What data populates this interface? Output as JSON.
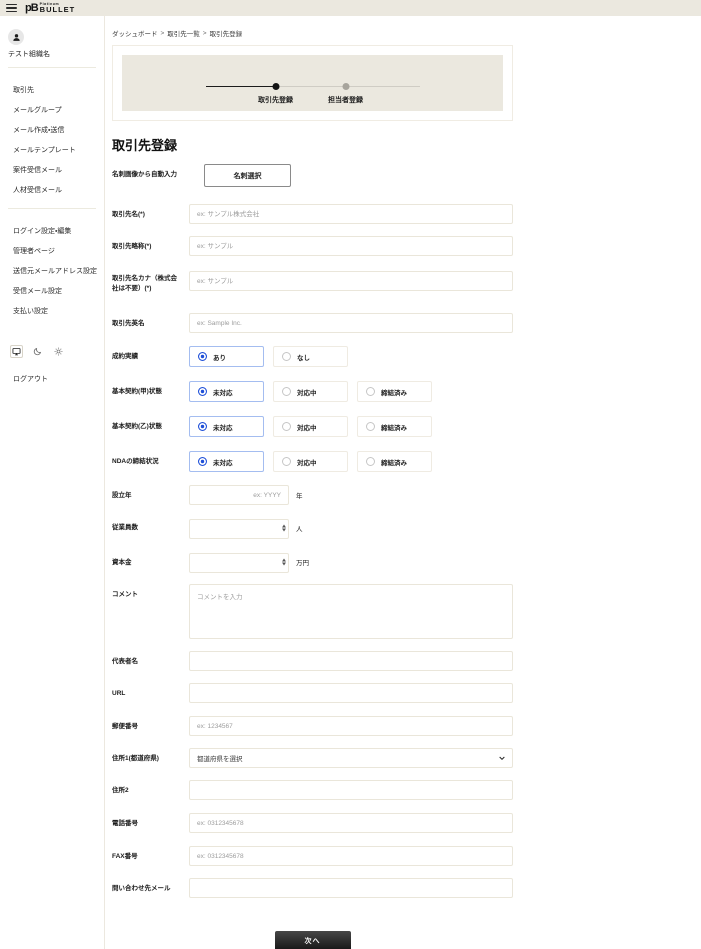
{
  "colors": {
    "accent_blue": "#1d4ed8",
    "selected_border": "#a4bdf0",
    "beige": "#ebe8df",
    "input_border": "#eae6da"
  },
  "header": {
    "logo_mark": "pB",
    "logo_small": "Platinum",
    "logo_main": "BULLET"
  },
  "sidebar": {
    "org_name": "テスト組織名",
    "nav_primary": [
      {
        "label": "取引先"
      },
      {
        "label": "メールグループ"
      },
      {
        "label": "メール作成・送信"
      },
      {
        "label": "メールテンプレート"
      },
      {
        "label": "案件受信メール"
      },
      {
        "label": "人材受信メール"
      }
    ],
    "nav_secondary": [
      {
        "label": "ログイン設定・編集"
      },
      {
        "label": "管理者ページ"
      },
      {
        "label": "送信元メールアドレス設定"
      },
      {
        "label": "受信メール設定"
      },
      {
        "label": "支払い設定"
      }
    ],
    "theme_icons": [
      "monitor-icon",
      "moon-icon",
      "sun-icon"
    ],
    "logout_label": "ログアウト"
  },
  "breadcrumb": {
    "items": [
      "ダッシュボード",
      "取引先一覧",
      "取引先登録"
    ],
    "separator": ">"
  },
  "stepper": {
    "steps": [
      {
        "label": "取引先登録",
        "state": "active"
      },
      {
        "label": "担当者登録",
        "state": "inactive"
      }
    ]
  },
  "form": {
    "title": "取引先登録",
    "business_card": {
      "label": "名刺画像から自動入力",
      "button_label": "名刺選択"
    },
    "fields": {
      "partner_name": {
        "label": "取引先名(*)",
        "placeholder": "ex: サンプル株式会社"
      },
      "partner_abbr": {
        "label": "取引先略称(*)",
        "placeholder": "ex: サンプル"
      },
      "partner_kana": {
        "label": "取引先名カナ（株式会社は不要）(*)",
        "placeholder": "ex: サンプル"
      },
      "partner_en": {
        "label": "取引先英名",
        "placeholder": "ex: Sample Inc."
      },
      "deal_record": {
        "label": "成約実績",
        "options": [
          "あり",
          "なし"
        ],
        "selected_index": 0
      },
      "contract_kou": {
        "label": "基本契約(甲)状態",
        "options": [
          "未対応",
          "対応中",
          "締結済み"
        ],
        "selected_index": 0
      },
      "contract_otsu": {
        "label": "基本契約(乙)状態",
        "options": [
          "未対応",
          "対応中",
          "締結済み"
        ],
        "selected_index": 0
      },
      "nda": {
        "label": "NDAの締結状況",
        "options": [
          "未対応",
          "対応中",
          "締結済み"
        ],
        "selected_index": 0
      },
      "founded_year": {
        "label": "設立年",
        "placeholder": "ex: YYYY",
        "unit": "年"
      },
      "employees": {
        "label": "従業員数",
        "unit": "人"
      },
      "capital": {
        "label": "資本金",
        "unit": "万円"
      },
      "comment": {
        "label": "コメント",
        "placeholder": "コメントを入力"
      },
      "representative": {
        "label": "代表者名"
      },
      "url": {
        "label": "URL"
      },
      "postal_code": {
        "label": "郵便番号",
        "placeholder": "ex: 1234567"
      },
      "address1": {
        "label": "住所1(都道府県)",
        "value": "都道府県を選択"
      },
      "address2": {
        "label": "住所2"
      },
      "phone": {
        "label": "電話番号",
        "placeholder": "ex: 0312345678"
      },
      "fax": {
        "label": "FAX番号",
        "placeholder": "ex: 0312345678"
      },
      "contact_email": {
        "label": "問い合わせ先メール"
      }
    },
    "submit_label": "次へ"
  }
}
